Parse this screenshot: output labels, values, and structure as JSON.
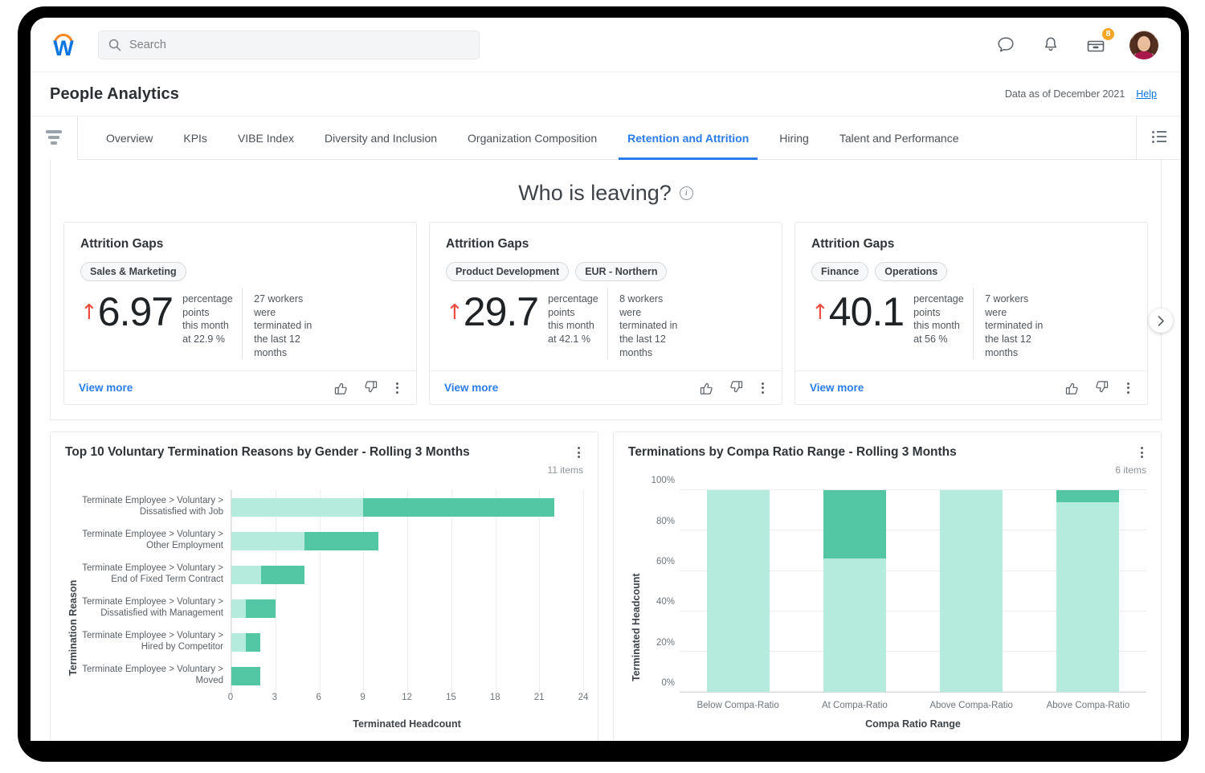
{
  "topbar": {
    "logo_name": "workday-logo",
    "search_placeholder": "Search",
    "search_value": "",
    "inbox_badge": "8"
  },
  "header": {
    "title": "People Analytics",
    "data_as_of": "Data as of December 2021",
    "help_label": "Help"
  },
  "tabs": [
    {
      "label": "Overview",
      "active": false
    },
    {
      "label": "KPIs",
      "active": false
    },
    {
      "label": "VIBE Index",
      "active": false
    },
    {
      "label": "Diversity and Inclusion",
      "active": false
    },
    {
      "label": "Organization Composition",
      "active": false
    },
    {
      "label": "Retention and Attrition",
      "active": true
    },
    {
      "label": "Hiring",
      "active": false
    },
    {
      "label": "Talent and Performance",
      "active": false
    }
  ],
  "section": {
    "heading": "Who is leaving?",
    "view_more_label": "View more"
  },
  "cards": [
    {
      "heading": "Attrition Gaps",
      "chips": [
        "Sales & Marketing"
      ],
      "trend": "↑",
      "value": "6.97",
      "unit_line1": "percentage",
      "unit_line2": "points",
      "unit_line3": "this month",
      "unit_line4": "at 22.9 %",
      "detail": "27 workers were terminated in the last 12 months",
      "view_more_label": "View more"
    },
    {
      "heading": "Attrition Gaps",
      "chips": [
        "Product Development",
        "EUR - Northern"
      ],
      "trend": "↑",
      "value": "29.7",
      "unit_line1": "percentage",
      "unit_line2": "points",
      "unit_line3": "this month",
      "unit_line4": "at 42.1 %",
      "detail": "8 workers were terminated in the last 12 months",
      "view_more_label": "View more"
    },
    {
      "heading": "Attrition Gaps",
      "chips": [
        "Finance",
        "Operations"
      ],
      "trend": "↑",
      "value": "40.1",
      "unit_line1": "percentage",
      "unit_line2": "points",
      "unit_line3": "this month",
      "unit_line4": "at 56 %",
      "detail": "7 workers were terminated in the last 12 months",
      "view_more_label": "View more"
    }
  ],
  "left_chart_meta": {
    "title": "Top 10 Voluntary Termination Reasons by Gender - Rolling 3 Months",
    "items": "11 items"
  },
  "right_chart_meta": {
    "title": "Terminations by Compa Ratio Range - Rolling 3 Months",
    "items": "6 items"
  },
  "colors": {
    "accent_blue": "#2B7CEB",
    "brand_orange": "#F6861F",
    "logo_blue": "#0875E1",
    "trend_red": "#F04A3F",
    "series_light_green": "#B5EBDC",
    "series_dark_green": "#53C6A4"
  },
  "chart_data": [
    {
      "type": "bar",
      "orientation": "horizontal",
      "stacked": true,
      "title": "Top 10 Voluntary Termination Reasons by Gender - Rolling 3 Months",
      "xlabel": "Terminated Headcount",
      "ylabel": "Termination Reason",
      "xlim": [
        0,
        24
      ],
      "xticks": [
        0,
        3,
        6,
        9,
        12,
        15,
        18,
        21,
        24
      ],
      "grid": true,
      "legend": "none",
      "categories": [
        "Terminate Employee > Voluntary > Dissatisfied with Job",
        "Terminate Employee > Voluntary > Other Employment",
        "Terminate Employee > Voluntary > End of Fixed Term Contract",
        "Terminate Employee > Voluntary > Dissatisfied with Management",
        "Terminate Employee > Voluntary > Hired by Competitor",
        "Terminate Employee > Voluntary > Moved"
      ],
      "series": [
        {
          "name": "Light segment",
          "color": "#B5EBDC",
          "values": [
            9,
            5,
            2,
            1,
            1,
            0
          ]
        },
        {
          "name": "Dark segment",
          "color": "#53C6A4",
          "values": [
            13,
            5,
            3,
            2,
            1,
            2
          ]
        }
      ],
      "totals": [
        22,
        10,
        5,
        3,
        2,
        2
      ]
    },
    {
      "type": "bar",
      "orientation": "vertical",
      "stacked": true,
      "title": "Terminations by Compa Ratio Range - Rolling 3 Months",
      "xlabel": "Compa Ratio Range",
      "ylabel": "Terminated Headcount",
      "ylim": [
        0,
        100
      ],
      "yticks": [
        "0%",
        "20%",
        "40%",
        "60%",
        "80%",
        "100%"
      ],
      "grid": true,
      "legend": "none",
      "categories": [
        "Below Compa-Ratio",
        "At Compa-Ratio",
        "Above Compa-Ratio",
        "Above Compa-Ratio"
      ],
      "series": [
        {
          "name": "Light segment",
          "color": "#B5EBDC",
          "values": [
            100,
            66,
            100,
            94
          ]
        },
        {
          "name": "Dark segment",
          "color": "#53C6A4",
          "values": [
            0,
            34,
            0,
            6
          ]
        }
      ]
    }
  ]
}
